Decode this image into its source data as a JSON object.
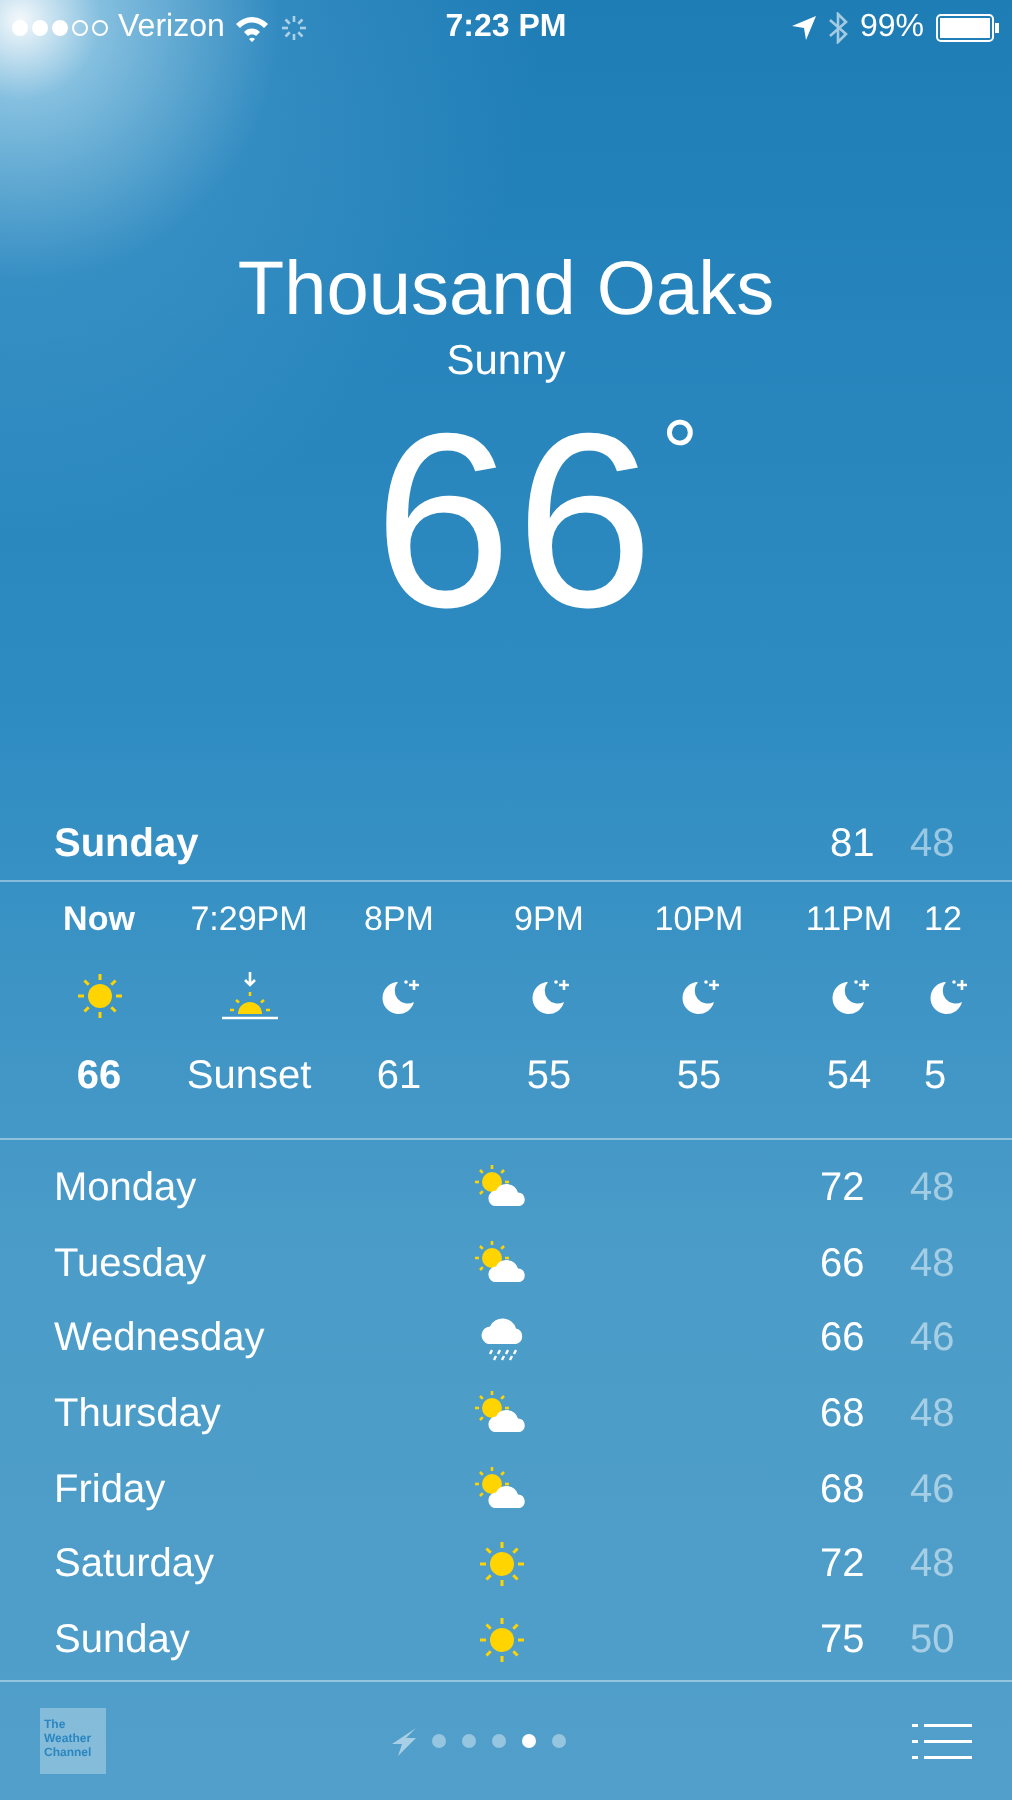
{
  "status_bar": {
    "signal_dots": [
      {
        "filled": true
      },
      {
        "filled": true
      },
      {
        "filled": true
      },
      {
        "filled": false
      },
      {
        "filled": false
      }
    ],
    "carrier": "Verizon",
    "time": "7:23 PM",
    "battery": "99%"
  },
  "location": {
    "city": "Thousand Oaks",
    "condition": "Sunny",
    "temperature": "66",
    "degree": "°"
  },
  "today": {
    "day": "Sunday",
    "high": "81",
    "low": "48"
  },
  "hourly": [
    {
      "time": "Now",
      "kind": "sun",
      "value": "66",
      "selected": true
    },
    {
      "time": "7:29PM",
      "kind": "sunset",
      "value": "Sunset",
      "selected": false
    },
    {
      "time": "8PM",
      "kind": "moon",
      "value": "61",
      "selected": false
    },
    {
      "time": "9PM",
      "kind": "moon",
      "value": "55",
      "selected": false
    },
    {
      "time": "10PM",
      "kind": "moon",
      "value": "55",
      "selected": false
    },
    {
      "time": "11PM",
      "kind": "moon",
      "value": "54",
      "selected": false
    },
    {
      "time": "12",
      "kind": "moon",
      "value": "5",
      "selected": false
    }
  ],
  "daily": [
    {
      "day": "Monday",
      "kind": "partly-cloudy",
      "high": "72",
      "low": "48"
    },
    {
      "day": "Tuesday",
      "kind": "partly-cloudy",
      "high": "66",
      "low": "48"
    },
    {
      "day": "Wednesday",
      "kind": "rain",
      "high": "66",
      "low": "46"
    },
    {
      "day": "Thursday",
      "kind": "partly-cloudy",
      "high": "68",
      "low": "48"
    },
    {
      "day": "Friday",
      "kind": "partly-cloudy",
      "high": "68",
      "low": "46"
    },
    {
      "day": "Saturday",
      "kind": "sun",
      "high": "72",
      "low": "48"
    },
    {
      "day": "Sunday",
      "kind": "sun",
      "high": "75",
      "low": "50"
    }
  ],
  "bottom_bar": {
    "logo": "The Weather Channel",
    "pages": [
      {
        "selected": false
      },
      {
        "selected": false
      },
      {
        "selected": false
      },
      {
        "selected": true
      },
      {
        "selected": false
      }
    ]
  }
}
